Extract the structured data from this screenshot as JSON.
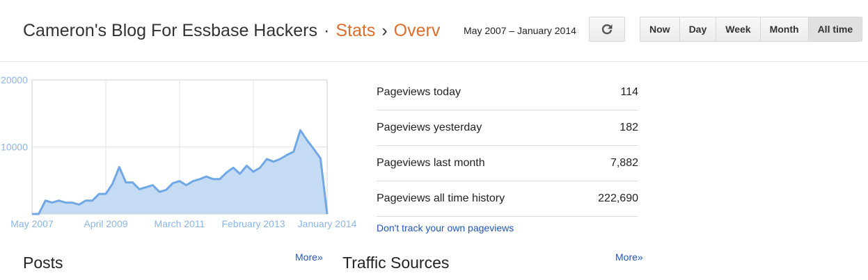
{
  "header": {
    "blog_title": "Cameron's Blog For Essbase Hackers",
    "separator": "·",
    "crumb_stats": "Stats",
    "crumb_arrow": "›",
    "crumb_overview": "Overv",
    "date_range": "May 2007 – January 2014",
    "refresh_icon": "refresh-icon",
    "ranges": [
      "Now",
      "Day",
      "Week",
      "Month",
      "All time"
    ],
    "active_range": "All time"
  },
  "chart_data": {
    "type": "area",
    "x_tick_labels": [
      "May 2007",
      "April 2009",
      "March 2011",
      "February 2013",
      "January 2014"
    ],
    "y_tick_labels": [
      "20000",
      "10000"
    ],
    "ylim": [
      0,
      20000
    ],
    "grid": true,
    "color": "#6fa8e4",
    "fill": "#c5daf3",
    "values": [
      0,
      0,
      2000,
      1700,
      2000,
      1700,
      1700,
      1400,
      2000,
      2000,
      3000,
      3000,
      4500,
      7000,
      4700,
      4700,
      3700,
      4000,
      4300,
      3300,
      3600,
      4600,
      4900,
      4300,
      4900,
      5200,
      5600,
      5200,
      5200,
      6200,
      6900,
      6000,
      7200,
      6300,
      6900,
      8200,
      7800,
      8200,
      8800,
      9300,
      12500,
      11000,
      9700,
      8300,
      0
    ]
  },
  "stats": [
    {
      "label": "Pageviews today",
      "value": "114"
    },
    {
      "label": "Pageviews yesterday",
      "value": "182"
    },
    {
      "label": "Pageviews last month",
      "value": "7,882"
    },
    {
      "label": "Pageviews all time history",
      "value": "222,690"
    }
  ],
  "dont_track_link": "Don't track your own pageviews",
  "sections": {
    "posts_title": "Posts",
    "traffic_title": "Traffic Sources",
    "more_label": "More»"
  }
}
